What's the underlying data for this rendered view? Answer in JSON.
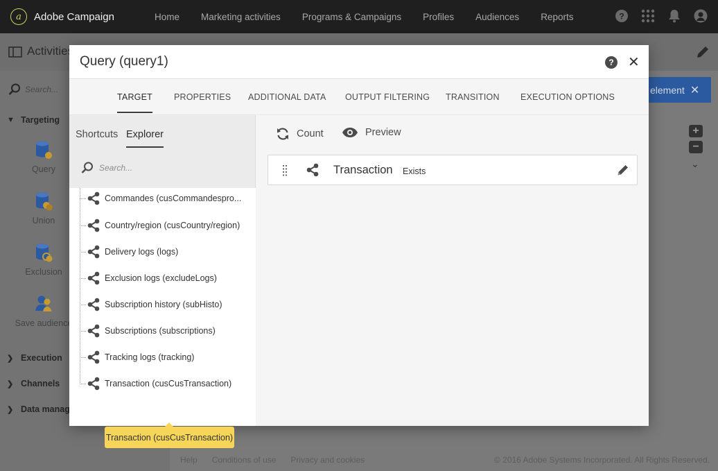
{
  "app": {
    "name": "Adobe Campaign",
    "logo_glyph": "a",
    "nav": [
      "Home",
      "Marketing activities",
      "Programs & Campaigns",
      "Profiles",
      "Audiences",
      "Reports"
    ]
  },
  "subheader": {
    "title": "Activities"
  },
  "sidebar": {
    "search_placeholder": "Search...",
    "sections": [
      {
        "label": "Targeting",
        "expanded": true
      },
      {
        "label": "Execution",
        "expanded": false
      },
      {
        "label": "Channels",
        "expanded": false
      },
      {
        "label": "Data manage",
        "expanded": false
      }
    ],
    "items": [
      {
        "label": "Query",
        "icon": "database-icon"
      },
      {
        "label": "Union",
        "icon": "union-icon"
      },
      {
        "label": "Exclusion",
        "icon": "exclusion-icon"
      },
      {
        "label": "Save audience",
        "icon": "audience-icon"
      }
    ]
  },
  "canvas": {
    "element_button": "element"
  },
  "footer": {
    "links": [
      "Help",
      "Conditions of use",
      "Privacy and cookies"
    ],
    "copyright": "© 2016 Adobe Systems Incorporated. All Rights Reserved."
  },
  "modal": {
    "title": "Query (query1)",
    "tabs": [
      "TARGET",
      "PROPERTIES",
      "ADDITIONAL DATA",
      "OUTPUT FILTERING",
      "TRANSITION",
      "EXECUTION OPTIONS"
    ],
    "active_tab": "TARGET",
    "subtabs": [
      "Shortcuts",
      "Explorer"
    ],
    "active_subtab": "Explorer",
    "search_placeholder": "Search...",
    "tree_items": [
      "Commandes (cusCommandespro...",
      "Country/region (cusCountry/region)",
      "Delivery logs (logs)",
      "Exclusion logs (excludeLogs)",
      "Subscription history (subHisto)",
      "Subscriptions (subscriptions)",
      "Tracking logs (tracking)",
      "Transaction (cusCusTransaction)"
    ],
    "toolbar": {
      "count": "Count",
      "preview": "Preview"
    },
    "condition": {
      "name": "Transaction",
      "operator": "Exists"
    },
    "tooltip": "Transaction (cusCusTransaction)"
  },
  "colors": {
    "accent_blue": "#2c5aa0",
    "tooltip_yellow": "#f7d559",
    "topbar": "#1f1f1f"
  }
}
